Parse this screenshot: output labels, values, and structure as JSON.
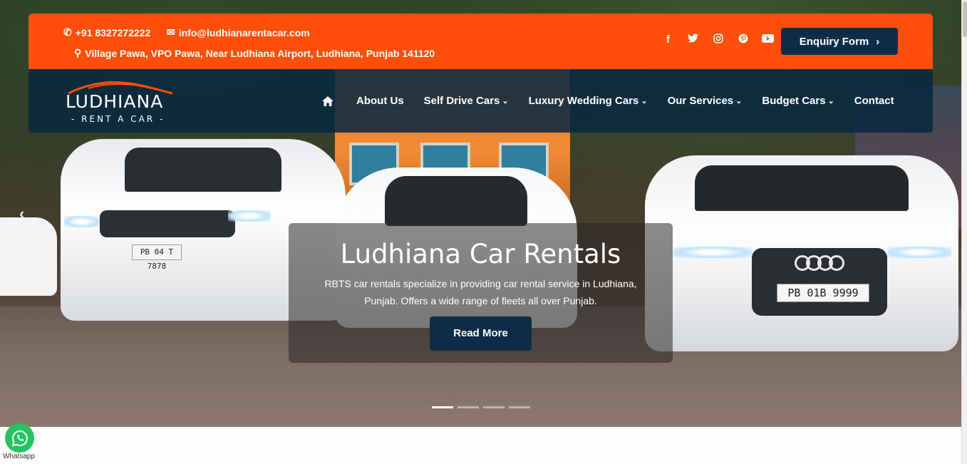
{
  "topbar": {
    "phone": "+91 8327272222",
    "email": "info@ludhianarentacar.com",
    "address": "Village Pawa, VPO Pawa, Near Ludhiana Airport, Ludhiana, Punjab 141120",
    "socials": [
      {
        "name": "facebook-icon",
        "glyph": "f"
      },
      {
        "name": "twitter-icon",
        "glyph": "🐦"
      },
      {
        "name": "instagram-icon",
        "glyph": "◎"
      },
      {
        "name": "pinterest-icon",
        "glyph": "℗"
      },
      {
        "name": "youtube-icon",
        "glyph": "▶"
      }
    ],
    "enquiry_label": "Enquiry Form",
    "accent": "#ff4f0a"
  },
  "logo": {
    "wordmark": "LUDHIANA",
    "tagline": "- RENT A CAR -"
  },
  "nav": {
    "home_icon": "home-icon",
    "items": [
      {
        "label": "About Us",
        "dropdown": false
      },
      {
        "label": "Self Drive Cars",
        "dropdown": true
      },
      {
        "label": "Luxury Wedding Cars",
        "dropdown": true
      },
      {
        "label": "Our Services",
        "dropdown": true
      },
      {
        "label": "Budget Cars",
        "dropdown": true
      },
      {
        "label": "Contact",
        "dropdown": false
      }
    ],
    "bg": "#0d2d47"
  },
  "hero": {
    "title": "Ludhiana Car Rentals",
    "text": "RBTS car rentals specialize in providing car rental service in Ludhiana, Punjab. Offers a wide range of fleets all over Punjab.",
    "button_label": "Read More",
    "slides": 4,
    "active_slide": 1,
    "plate_left": "PB 04 T 7878",
    "plate_right": "PB 01B 9999"
  },
  "whatsapp": {
    "label": "Whatsapp",
    "color": "#23c461"
  }
}
